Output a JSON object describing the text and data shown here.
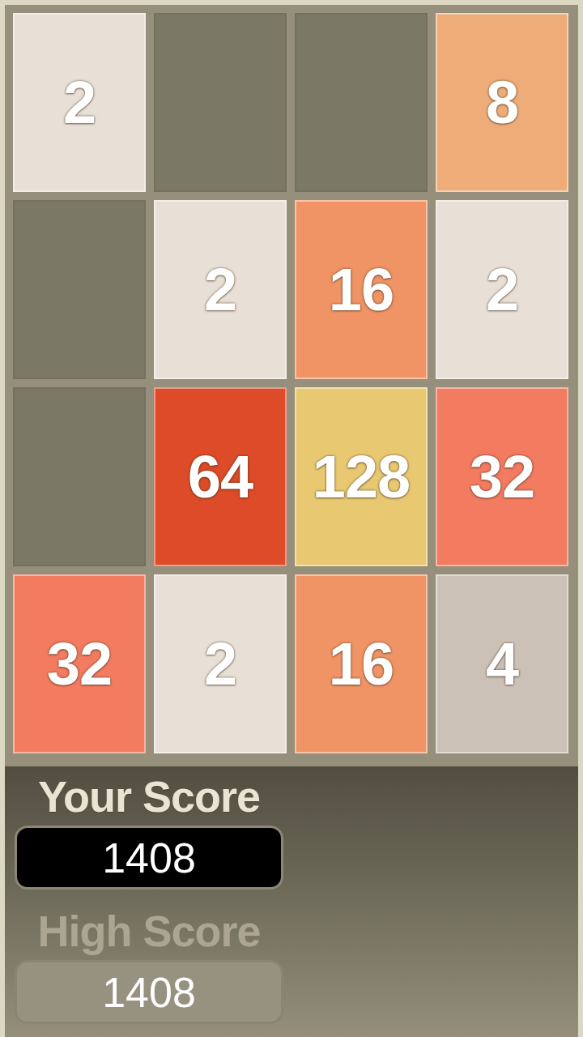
{
  "board": {
    "rows": [
      {
        "tiles": [
          {
            "kind": "number",
            "value": "2",
            "color": "#e8e0d6"
          },
          {
            "kind": "empty",
            "color": "#7b7866"
          },
          {
            "kind": "empty",
            "color": "#7b7866"
          },
          {
            "kind": "number",
            "value": "8",
            "color": "#eead78"
          }
        ]
      },
      {
        "tiles": [
          {
            "kind": "empty",
            "color": "#7b7866"
          },
          {
            "kind": "number",
            "value": "2",
            "color": "#e8e0d6"
          },
          {
            "kind": "number",
            "value": "16",
            "color": "#f09465"
          },
          {
            "kind": "number",
            "value": "2",
            "color": "#e8e0d6"
          }
        ]
      },
      {
        "tiles": [
          {
            "kind": "empty",
            "color": "#7b7866"
          },
          {
            "kind": "number",
            "value": "64",
            "color": "#dd4b28"
          },
          {
            "kind": "number",
            "value": "128",
            "color": "#e8c870"
          },
          {
            "kind": "number",
            "value": "32",
            "color": "#f27b60"
          }
        ]
      },
      {
        "tiles": [
          {
            "kind": "number",
            "value": "32",
            "color": "#f27b60"
          },
          {
            "kind": "number",
            "value": "2",
            "color": "#e8e0d6"
          },
          {
            "kind": "number",
            "value": "16",
            "color": "#f09465"
          },
          {
            "kind": "number",
            "value": "4",
            "color": "#cbc1b6"
          }
        ]
      }
    ]
  },
  "scores": [
    {
      "kind": "current",
      "label": "Your Score",
      "value": "1408"
    },
    {
      "kind": "high",
      "label": "High Score",
      "value": "1408"
    }
  ]
}
